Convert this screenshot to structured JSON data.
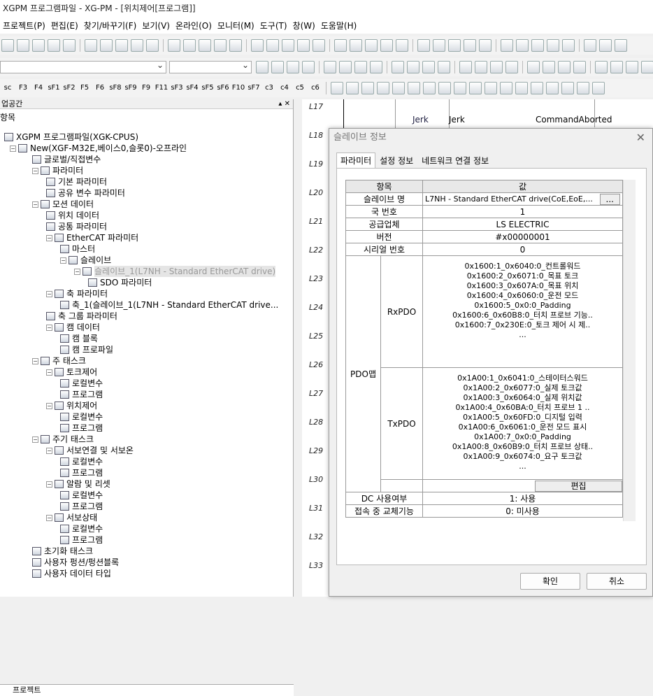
{
  "window": {
    "title": "XGPM 프로그램파일 - XG-PM - [위치제어[프로그램]]"
  },
  "menu": [
    "프로젝트(P)",
    "편집(E)",
    "찾기/바꾸기(F)",
    "보기(V)",
    "온라인(O)",
    "모니터(M)",
    "도구(T)",
    "창(W)",
    "도움말(H)"
  ],
  "fkeys": [
    "sc",
    "F3",
    "F4",
    "sF1",
    "sF2",
    "F5",
    "F6",
    "sF8",
    "sF9",
    "F9",
    "F11",
    "sF3",
    "sF4",
    "sF5",
    "sF6",
    "F10",
    "sF7",
    "c3",
    "c4",
    "c5",
    "c6"
  ],
  "pane": {
    "title": "업공간",
    "section": "항목",
    "bottom_tab": "프로젝트"
  },
  "tree": [
    {
      "label": "XGPM 프로그램파일(XGK-CPUS)"
    },
    {
      "label": "New(XGF-M32E,베이스0,슬롯0)-오프라인"
    },
    {
      "label": "글로벌/직접변수"
    },
    {
      "label": "파라미터"
    },
    {
      "label": "기본 파라미터"
    },
    {
      "label": "공유 변수 파라미터"
    },
    {
      "label": "모션 데이터"
    },
    {
      "label": "위치 데이터"
    },
    {
      "label": "공통 파라미터"
    },
    {
      "label": "EtherCAT 파라미터"
    },
    {
      "label": "마스터"
    },
    {
      "label": "슬레이브"
    },
    {
      "label": "슬레이브_1(L7NH - Standard EtherCAT drive)"
    },
    {
      "label": "SDO 파라미터"
    },
    {
      "label": "축 파라미터"
    },
    {
      "label": "축_1(슬레이브_1(L7NH - Standard EtherCAT drive..."
    },
    {
      "label": "축 그룹 파라미터"
    },
    {
      "label": "캠 데이터"
    },
    {
      "label": "캠 블록"
    },
    {
      "label": "캠 프로파일"
    },
    {
      "label": "주 태스크"
    },
    {
      "label": "토크제어"
    },
    {
      "label": "로컬변수"
    },
    {
      "label": "프로그램"
    },
    {
      "label": "위치제어"
    },
    {
      "label": "로컬변수"
    },
    {
      "label": "프로그램"
    },
    {
      "label": "주기 태스크"
    },
    {
      "label": "서보연결 및 서보온"
    },
    {
      "label": "로컬변수"
    },
    {
      "label": "프로그램"
    },
    {
      "label": "알람 및 리셋"
    },
    {
      "label": "로컬변수"
    },
    {
      "label": "프로그램"
    },
    {
      "label": "서보상태"
    },
    {
      "label": "로컬변수"
    },
    {
      "label": "프로그램"
    },
    {
      "label": "초기화 태스크"
    },
    {
      "label": "사용자 펑션/펑션블록"
    },
    {
      "label": "사용자 데이터 타입"
    }
  ],
  "ladder": {
    "rungs": [
      "L17",
      "L18",
      "L19",
      "L20",
      "L21",
      "L22",
      "L23",
      "L24",
      "L25",
      "L26",
      "L27",
      "L28",
      "L29",
      "L30",
      "L31",
      "L32",
      "L33"
    ],
    "row17": {
      "a": "Jerk",
      "b": "Jerk",
      "c": "CommandAborted"
    }
  },
  "dialog": {
    "title": "슬레이브 정보",
    "tabs": [
      "파라미터",
      "설정 정보",
      "네트워크 연결 정보"
    ],
    "table": {
      "col_item": "항목",
      "col_value": "값",
      "rows": [
        {
          "item": "슬레이브 명",
          "value": "L7NH - Standard EtherCAT drive(CoE,EoE,..."
        },
        {
          "item": "국 번호",
          "value": "1"
        },
        {
          "item": "공급업체",
          "value": "LS ELECTRIC"
        },
        {
          "item": "버전",
          "value": "#x00000001"
        },
        {
          "item": "시리얼 번호",
          "value": "0"
        }
      ],
      "pdo_label": "PDO맵",
      "rxpdo_label": "RxPDO",
      "rxpdo": [
        "0x1600:1_0x6040:0_컨트롤워드",
        "0x1600:2_0x6071:0_목표 토크",
        "0x1600:3_0x607A:0_목표 위치",
        "0x1600:4_0x6060:0_운전 모드",
        "0x1600:5_0x0:0_Padding",
        "0x1600:6_0x60B8:0_터치 프로브 기능..",
        "0x1600:7_0x230E:0_토크 제어 시 제..",
        "..."
      ],
      "txpdo_label": "TxPDO",
      "txpdo": [
        "0x1A00:1_0x6041:0_스테이터스워드",
        "0x1A00:2_0x6077:0_실제 토크값",
        "0x1A00:3_0x6064:0_실제 위치값",
        "0x1A00:4_0x60BA:0_터치 프로브 1 ..",
        "0x1A00:5_0x60FD:0_디지털 입력",
        "0x1A00:6_0x6061:0_운전 모드 표시",
        "0x1A00:7_0x0:0_Padding",
        "0x1A00:8_0x60B9:0_터치 프로브 상태..",
        "0x1A00:9_0x6074:0_요구 토크값",
        "..."
      ],
      "edit_label": "편집",
      "dc_item": "DC 사용여부",
      "dc_value": "1: 사용",
      "hotconnect_item": "접속 중 교체기능",
      "hotconnect_value": "0: 미사용"
    },
    "ok": "확인",
    "cancel": "취소"
  }
}
